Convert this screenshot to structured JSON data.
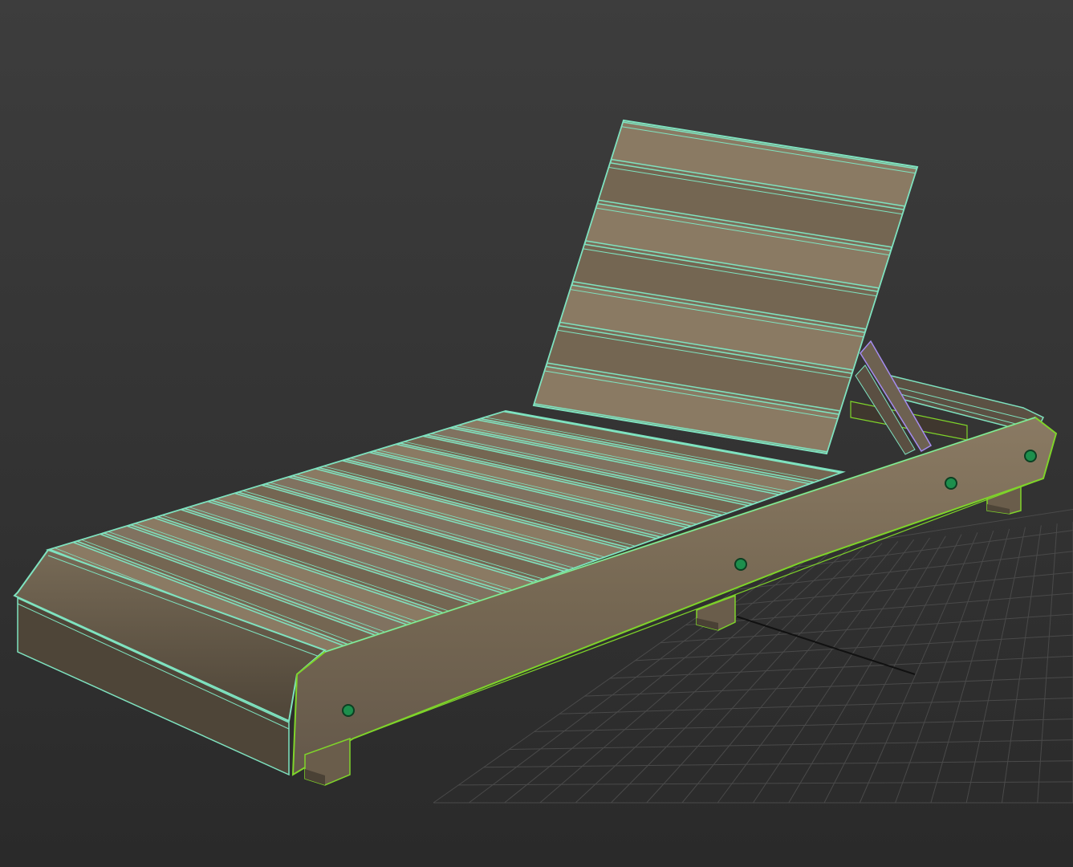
{
  "viewport": {
    "background_top": "#3d3d3d",
    "background_bottom": "#2a2a2a",
    "grid_color": "#4a4a4a",
    "axis_color": "#111111"
  },
  "model": {
    "wood_light": "#8a7a63",
    "wood_mid": "#746652",
    "wood_dark": "#5c5142",
    "wood_shadow": "#4a4135",
    "plank_edge_color": "#7fe3c0",
    "frame_edge_color": "#7fd42a",
    "bolt_color": "#1d8f4d",
    "back_slat_count": 7,
    "seat_slat_count": 17
  }
}
